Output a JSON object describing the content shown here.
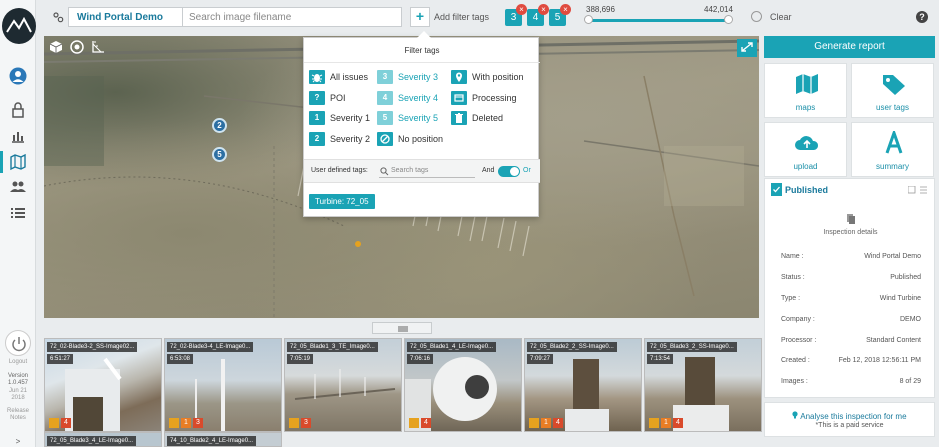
{
  "nav": {
    "footer_line1": "Logout",
    "version_label": "Version",
    "version_number": "1.0.457",
    "date_line1": "Jun 21",
    "date_line2": "2018",
    "footer_line2": "Release",
    "footer_line3": "Notes"
  },
  "topbar": {
    "portal_name": "Wind Portal Demo",
    "search_placeholder": "Search image filename",
    "add_filter_label": "Add filter tags",
    "active_severity_chips": [
      "3",
      "4",
      "5"
    ],
    "range_min": "388,696",
    "range_max": "442,014",
    "range_low_fraction": 0.0,
    "range_high_fraction": 1.0,
    "clear_label": "Clear",
    "help_label": "?"
  },
  "map": {
    "markers": [
      "2",
      "5"
    ]
  },
  "filter_popup": {
    "title": "Filter tags",
    "tags": [
      {
        "id": "all",
        "label": "All issues",
        "icon": "bug-icon"
      },
      {
        "id": "sev3",
        "label": "Severity 3",
        "icon": "3"
      },
      {
        "id": "withpos",
        "label": "With position",
        "icon": "pin-icon"
      },
      {
        "id": "poi",
        "label": "POI",
        "icon": "?"
      },
      {
        "id": "sev4",
        "label": "Severity 4",
        "icon": "4"
      },
      {
        "id": "processing",
        "label": "Processing",
        "icon": "list-icon"
      },
      {
        "id": "sev1",
        "label": "Severity 1",
        "icon": "1"
      },
      {
        "id": "sev5",
        "label": "Severity 5",
        "icon": "5"
      },
      {
        "id": "deleted",
        "label": "Deleted",
        "icon": "trash-icon"
      },
      {
        "id": "sev2",
        "label": "Severity 2",
        "icon": "2"
      },
      {
        "id": "nopos",
        "label": "No position",
        "icon": "no-position-icon"
      }
    ],
    "user_defined_label": "User defined tags:",
    "search_tags_placeholder": "Search tags",
    "and_label": "And",
    "or_label": "Or",
    "selected_tag": "Turbine: 72_05"
  },
  "right_panel": {
    "generate_report": "Generate report",
    "tiles": [
      {
        "label": "maps",
        "icon": "map-icon"
      },
      {
        "label": "user tags",
        "icon": "tag-icon"
      },
      {
        "label": "upload",
        "icon": "cloud-upload-icon"
      },
      {
        "label": "summary",
        "icon": "summary-icon"
      }
    ],
    "published_label": "Published",
    "inspection_details_label": "Inspection details",
    "details": [
      {
        "k": "Name :",
        "v": "Wind Portal Demo"
      },
      {
        "k": "Status :",
        "v": "Published"
      },
      {
        "k": "Type :",
        "v": "Wind Turbine"
      },
      {
        "k": "Company :",
        "v": "DEMO"
      },
      {
        "k": "Processor :",
        "v": "Standard Content"
      },
      {
        "k": "Created :",
        "v": "Feb 12, 2018 12:56:11 PM"
      },
      {
        "k": "Images :",
        "v": "8 of 29"
      }
    ],
    "analyse_label": "Analyse this inspection for me",
    "paid_label": "*This is a paid service"
  },
  "thumbnails": [
    {
      "title": "72_02-Blade3-2_SS-Image02...",
      "time": "6:51:27",
      "badges": [
        "y",
        "r"
      ],
      "nums": [
        "",
        "4"
      ]
    },
    {
      "title": "72_02-Blade3-4_LE-Image0...",
      "time": "6:53:08",
      "badges": [
        "y",
        "o",
        "r"
      ],
      "nums": [
        "",
        "1",
        "3"
      ]
    },
    {
      "title": "72_05_Blade1_3_TE_Image0...",
      "time": "7:05:19",
      "badges": [
        "y",
        "r"
      ],
      "nums": [
        "",
        "3"
      ]
    },
    {
      "title": "72_05_Blade1_4_LE-Image0...",
      "time": "7:06:16",
      "badges": [
        "y",
        "r"
      ],
      "nums": [
        "",
        "4"
      ]
    },
    {
      "title": "72_05_Blade2_2_SS-Image0...",
      "time": "7:09:27",
      "badges": [
        "y",
        "o",
        "r"
      ],
      "nums": [
        "",
        "1",
        "4"
      ]
    },
    {
      "title": "72_05_Blade3_2_SS-Image0...",
      "time": "7:13:54",
      "badges": [
        "y",
        "o",
        "r"
      ],
      "nums": [
        "",
        "1",
        "4"
      ]
    },
    {
      "title": "72_05_Blade3_4_LE-Image0...",
      "time": "",
      "badges": [],
      "nums": []
    },
    {
      "title": "74_10_Blade2_4_LE-Image0...",
      "time": "",
      "badges": [],
      "nums": []
    }
  ],
  "colors": {
    "accent": "#1aa3b5",
    "link": "#1a7a9c",
    "remove": "#e04b3f",
    "badge_yellow": "#e6a21f",
    "badge_orange": "#e87d24",
    "badge_red": "#d94a2b"
  }
}
